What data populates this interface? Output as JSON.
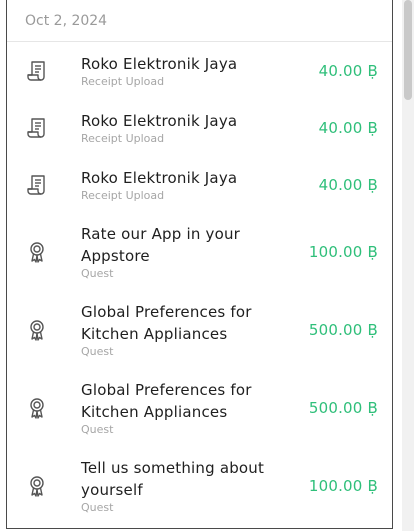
{
  "date_header": "Oct 2, 2024",
  "colors": {
    "amount": "#2fbf7a",
    "title": "#1f1f1f",
    "subtitle": "#a6a6a6",
    "icon": "#555555"
  },
  "items": [
    {
      "icon": "receipt-icon",
      "title": "Roko Elektronik Jaya",
      "subtitle": "Receipt Upload",
      "amount": "40.00 Ḅ"
    },
    {
      "icon": "receipt-icon",
      "title": "Roko Elektronik Jaya",
      "subtitle": "Receipt Upload",
      "amount": "40.00 Ḅ"
    },
    {
      "icon": "receipt-icon",
      "title": "Roko Elektronik Jaya",
      "subtitle": "Receipt Upload",
      "amount": "40.00 Ḅ"
    },
    {
      "icon": "award-icon",
      "title": "Rate our App in your Appstore",
      "subtitle": "Quest",
      "amount": "100.00 Ḅ"
    },
    {
      "icon": "award-icon",
      "title": "Global Preferences for Kitchen Appliances",
      "subtitle": "Quest",
      "amount": "500.00 Ḅ"
    },
    {
      "icon": "award-icon",
      "title": "Global Preferences for Kitchen Appliances",
      "subtitle": "Quest",
      "amount": "500.00 Ḅ"
    },
    {
      "icon": "award-icon",
      "title": "Tell us something about yourself",
      "subtitle": "Quest",
      "amount": "100.00 Ḅ"
    }
  ]
}
